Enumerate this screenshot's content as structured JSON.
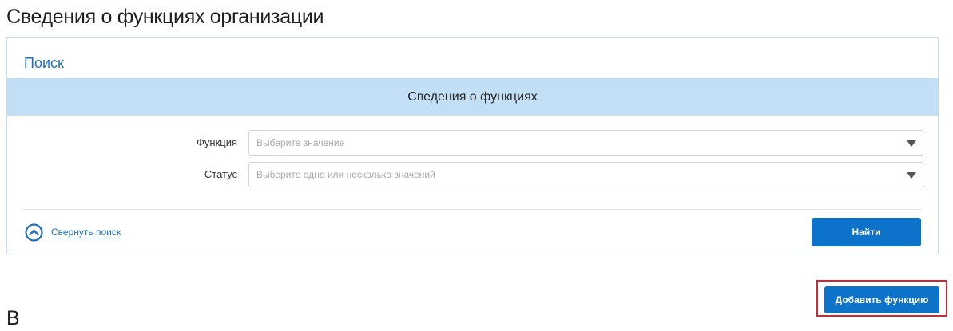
{
  "page": {
    "title": "Сведения о функциях организации",
    "next_heading_fragment": "В"
  },
  "search_panel": {
    "heading": "Поиск",
    "section_title": "Сведения о функциях",
    "fields": [
      {
        "label": "Функция",
        "placeholder": "Выберите значение",
        "icon": "dropdown-arrow-icon"
      },
      {
        "label": "Статус",
        "placeholder": "Выберите одно или несколько значений",
        "icon": "dropdown-arrow-icon"
      }
    ],
    "collapse_label": "Свернуть поиск",
    "collapse_icon": "chevron-up-circle-icon",
    "find_button": "Найти"
  },
  "actions": {
    "add_function_button": "Добавить функцию",
    "add_function_highlighted": true
  },
  "colors": {
    "accent": "#0d72c9",
    "link": "#1d6fbf",
    "section_band": "#c3dff5",
    "panel_border": "#c5dcee",
    "highlight": "#d9232e"
  }
}
